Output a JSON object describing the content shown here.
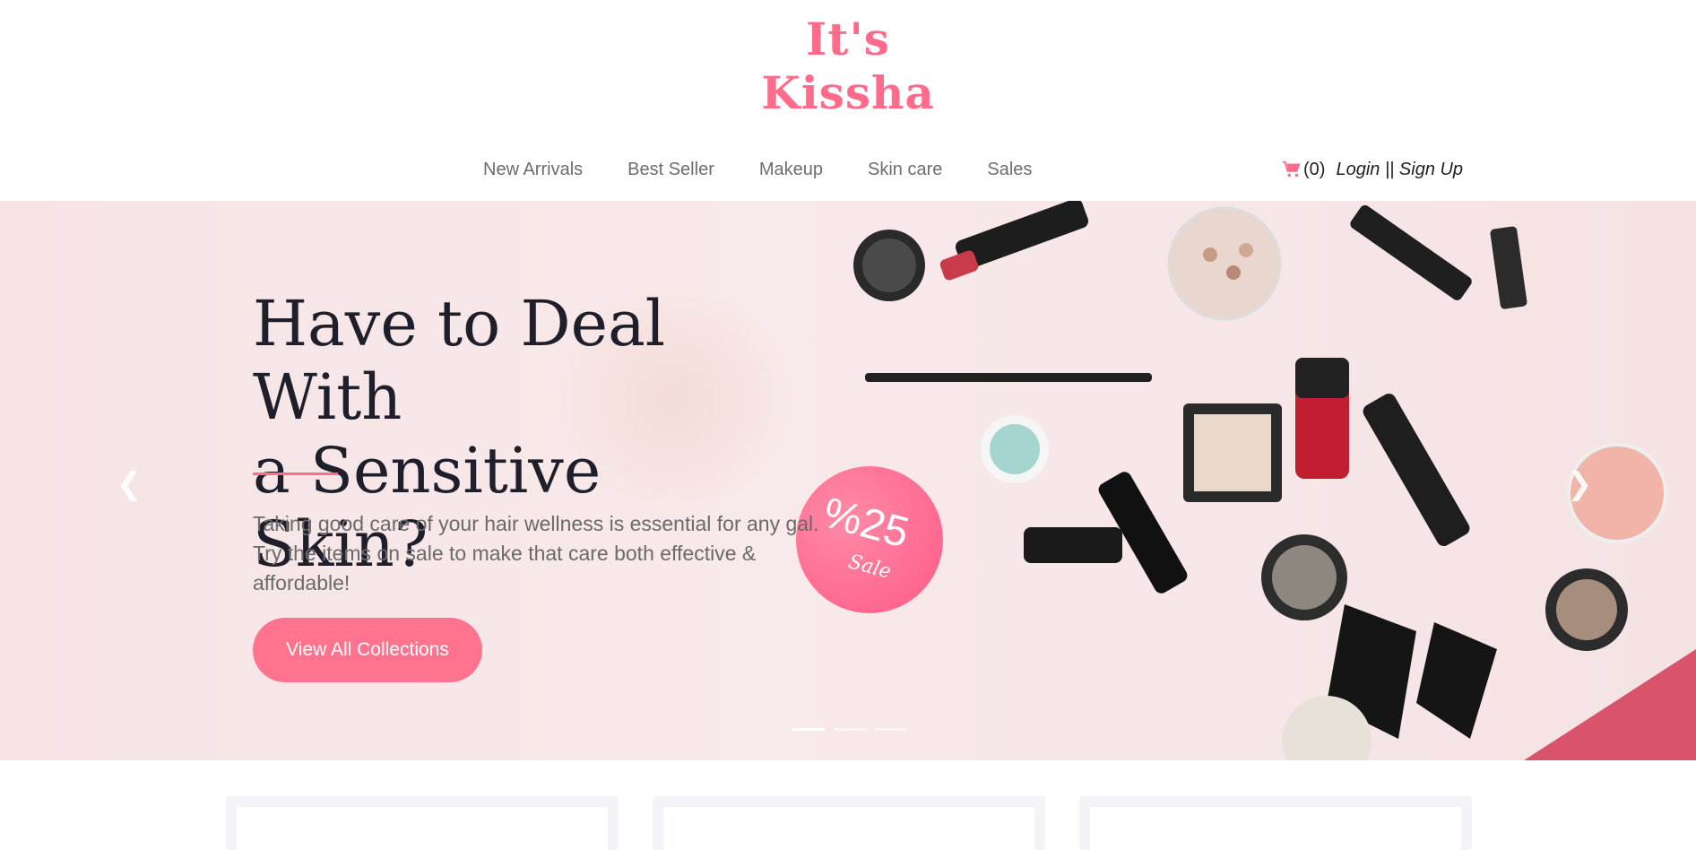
{
  "brand": {
    "line1": "It's",
    "line2": "Kissha",
    "color": "#ff6b8b"
  },
  "nav": {
    "items": [
      "New Arrivals",
      "Best Seller",
      "Makeup",
      "Skin care",
      "Sales"
    ]
  },
  "account": {
    "cart_icon": "shopping-cart-icon",
    "cart_count": "(0)",
    "login": "Login",
    "separator": "||",
    "signup": "Sign Up"
  },
  "hero": {
    "headline_line1": "Have to Deal With",
    "headline_line2": "a Sensitive Skin?",
    "description": "Taking good care of your hair wellness is essential for any gal. Try the items on sale to make that care both effective & affordable!",
    "cta_label": "View All Collections",
    "badge": {
      "percent": "%25",
      "label": "Sale"
    },
    "prev_icon": "chevron-left-icon",
    "next_icon": "chevron-right-icon",
    "slides": 3,
    "active_slide": 1
  },
  "colors": {
    "accent": "#ff738e",
    "headline": "#1f1f2b",
    "hero_bg": "#f6e4e5"
  }
}
